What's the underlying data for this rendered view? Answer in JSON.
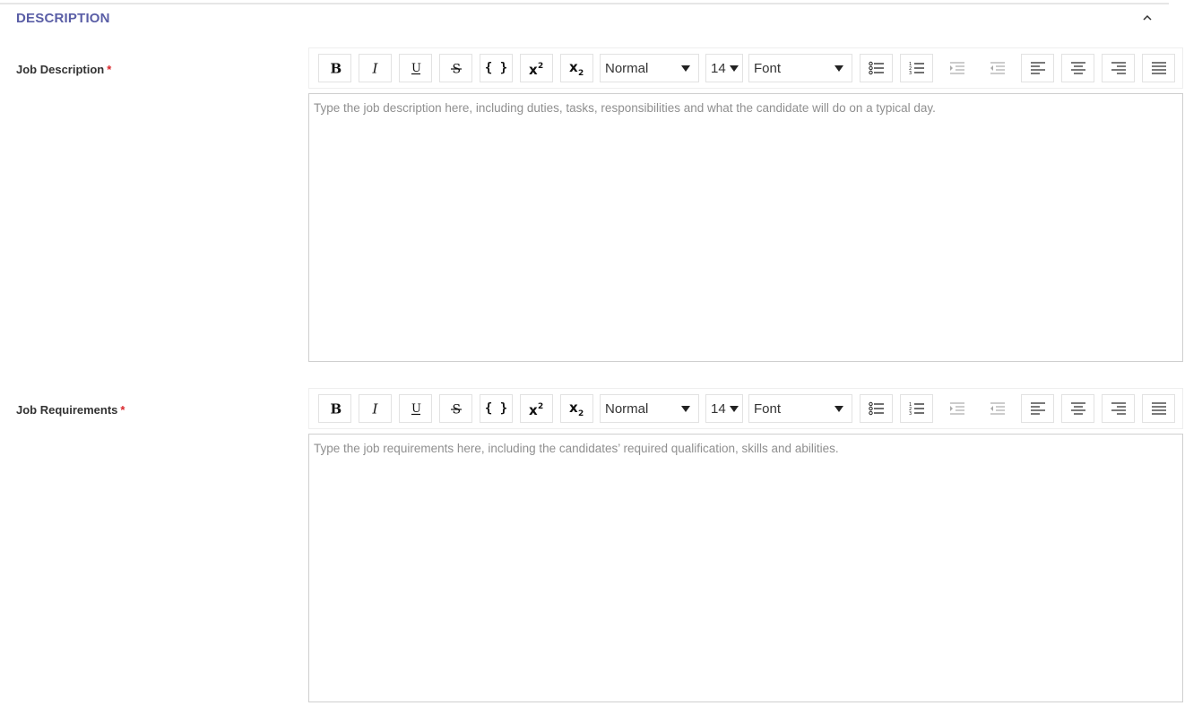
{
  "section": {
    "title": "DESCRIPTION",
    "collapse_icon": "chevron-up-icon"
  },
  "required_marker": "*",
  "toolbar": {
    "buttons": [
      {
        "name": "bold",
        "icon": "bold-icon"
      },
      {
        "name": "italic",
        "icon": "italic-icon"
      },
      {
        "name": "underline",
        "icon": "underline-icon"
      },
      {
        "name": "strikethrough",
        "icon": "strikethrough-icon"
      },
      {
        "name": "code-block",
        "icon": "code-braces-icon",
        "label": "{ }"
      },
      {
        "name": "superscript",
        "icon": "superscript-icon"
      },
      {
        "name": "subscript",
        "icon": "subscript-icon"
      },
      {
        "name": "bullet-list",
        "icon": "bullet-list-icon"
      },
      {
        "name": "numbered-list",
        "icon": "numbered-list-icon"
      },
      {
        "name": "indent",
        "icon": "indent-icon"
      },
      {
        "name": "outdent",
        "icon": "outdent-icon"
      },
      {
        "name": "align-left",
        "icon": "align-left-icon"
      },
      {
        "name": "align-center",
        "icon": "align-center-icon"
      },
      {
        "name": "align-right",
        "icon": "align-right-icon"
      },
      {
        "name": "align-justify",
        "icon": "align-justify-icon"
      }
    ],
    "block_format": "Normal",
    "font_size": "14",
    "font_family": "Font"
  },
  "fields": {
    "job_description": {
      "label": "Job Description",
      "placeholder": "Type the job description here, including duties, tasks, responsibilities and what the candidate will do on a typical day."
    },
    "job_requirements": {
      "label": "Job Requirements",
      "placeholder": "Type the job requirements here, including the candidates’ required qualification, skills and abilities."
    }
  }
}
